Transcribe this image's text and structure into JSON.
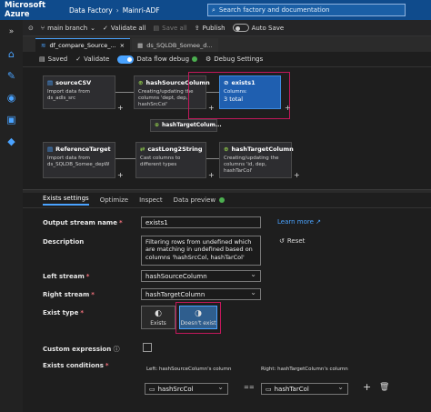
{
  "topbar": {
    "brand": "Microsoft Azure",
    "crumbs": [
      "Data Factory",
      "Mainri-ADF"
    ],
    "search_placeholder": "Search factory and documentation"
  },
  "toolbar": {
    "branch": "main branch",
    "validate_all": "Validate all",
    "save_all": "Save all",
    "publish": "Publish",
    "auto_save": "Auto Save"
  },
  "tabs": [
    {
      "label": "df_compare_Source_..."
    },
    {
      "label": "ds_SQLDB_Somee_d..."
    }
  ],
  "debugbar": {
    "saved": "Saved",
    "validate": "Validate",
    "data_flow_debug": "Data flow debug",
    "debug_settings": "Debug Settings"
  },
  "canvas": {
    "nodes": {
      "sourceCSV": {
        "title": "sourceCSV",
        "desc": "Import data from ds_adls_src"
      },
      "hashSourceColumn": {
        "title": "hashSourceColumn",
        "desc": "Creating/updating the columns 'dept, dep, hashSrcCol'"
      },
      "exists1": {
        "title": "exists1",
        "sub": "Columns:",
        "count": "3 total"
      },
      "hashTargetColumn_ref": {
        "title": "hashTargetColum..."
      },
      "ReferenceTarget": {
        "title": "ReferenceTarget",
        "desc": "Import data from ds_SQLDB_Somee_depW"
      },
      "castLong2String": {
        "title": "castLong2String",
        "desc": "Cast columns to different types"
      },
      "hashTargetColumn": {
        "title": "hashTargetColumn",
        "desc": "Creating/updating the columns 'id, dep, hashTarCol'"
      }
    }
  },
  "bottom_tabs": [
    "Exists settings",
    "Optimize",
    "Inspect",
    "Data preview"
  ],
  "settings": {
    "output_stream_label": "Output stream name",
    "output_stream_value": "exists1",
    "learn_more": "Learn more",
    "description_label": "Description",
    "description_value": "Filtering rows from undefined which are matching in undefined based on columns 'hashSrcCol, hashTarCol'",
    "reset": "Reset",
    "left_stream_label": "Left stream",
    "left_stream_value": "hashSourceColumn",
    "right_stream_label": "Right stream",
    "right_stream_value": "hashTargetColumn",
    "exist_type_label": "Exist type",
    "exists_option": "Exists",
    "doesnt_exist_option": "Doesn't exist",
    "custom_expression_label": "Custom expression",
    "exists_conditions_label": "Exists conditions",
    "left_col_header": "Left: hashSourceColumn's column",
    "right_col_header": "Right: hashTargetColumn's column",
    "left_col_value": "hashSrcCol",
    "operator": "==",
    "right_col_value": "hashTarCol"
  },
  "colors": {
    "accent": "#4aa3ff",
    "topbar": "#0f4b8c",
    "highlight": "#c2185b",
    "exists_node": "#1f5fb0"
  }
}
